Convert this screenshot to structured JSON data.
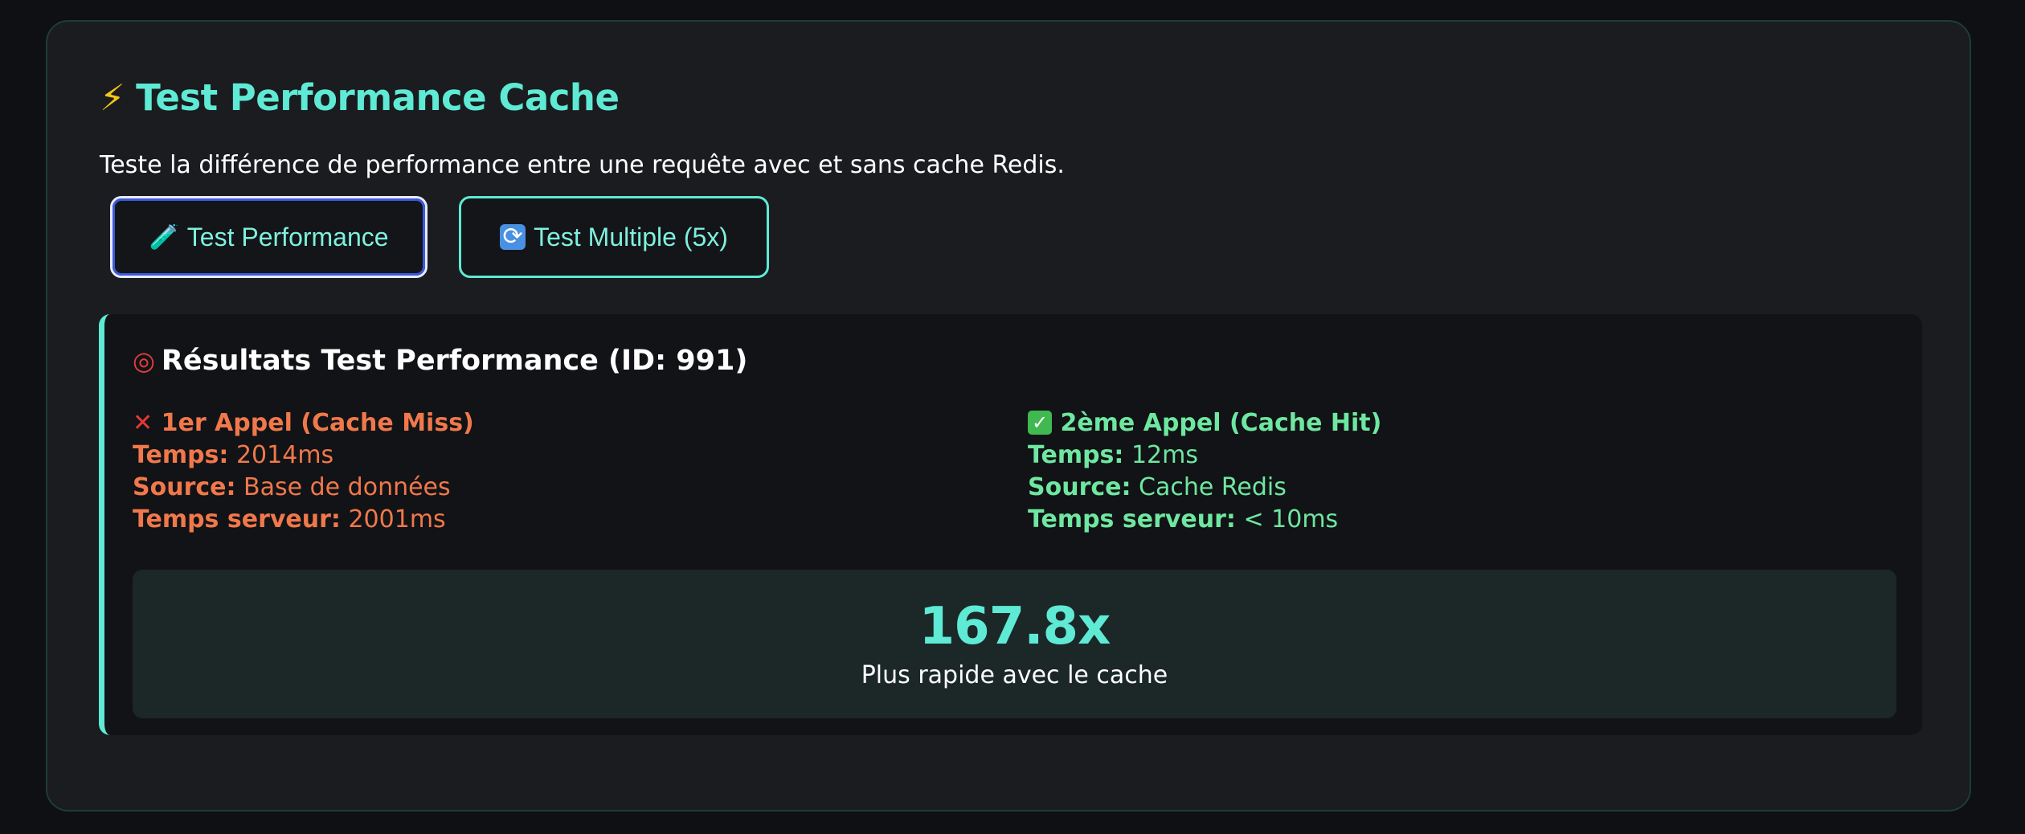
{
  "panel": {
    "title_icon": "⚡",
    "title": "Test Performance Cache",
    "description": "Teste la différence de performance entre une requête avec et sans cache Redis."
  },
  "buttons": {
    "test_performance": {
      "icon": "🧪",
      "icon_name": "test-tube-icon",
      "label": "Test Performance"
    },
    "test_multiple": {
      "icon": "🔄",
      "icon_name": "refresh-icon",
      "label": "Test Multiple (5x)"
    }
  },
  "results": {
    "icon": "🎯",
    "icon_name": "target-icon",
    "title": "Résultats Test Performance (ID: 991)",
    "cache_miss": {
      "icon": "❌",
      "heading": "1er Appel (Cache Miss)",
      "time_label": "Temps:",
      "time_value": "2014ms",
      "source_label": "Source:",
      "source_value": "Base de données",
      "server_label": "Temps serveur:",
      "server_value": "2001ms",
      "color": "#f0784b"
    },
    "cache_hit": {
      "icon": "✓",
      "heading": "2ème Appel (Cache Hit)",
      "time_label": "Temps:",
      "time_value": "12ms",
      "source_label": "Source:",
      "source_value": "Cache Redis",
      "server_label": "Temps serveur:",
      "server_value": "< 10ms",
      "color": "#6ee7a0"
    },
    "speedup": {
      "value": "167.8x",
      "label": "Plus rapide avec le cache"
    }
  },
  "colors": {
    "accent": "#5eead4",
    "background": "#0e1013",
    "panel": "#1a1c1f"
  }
}
